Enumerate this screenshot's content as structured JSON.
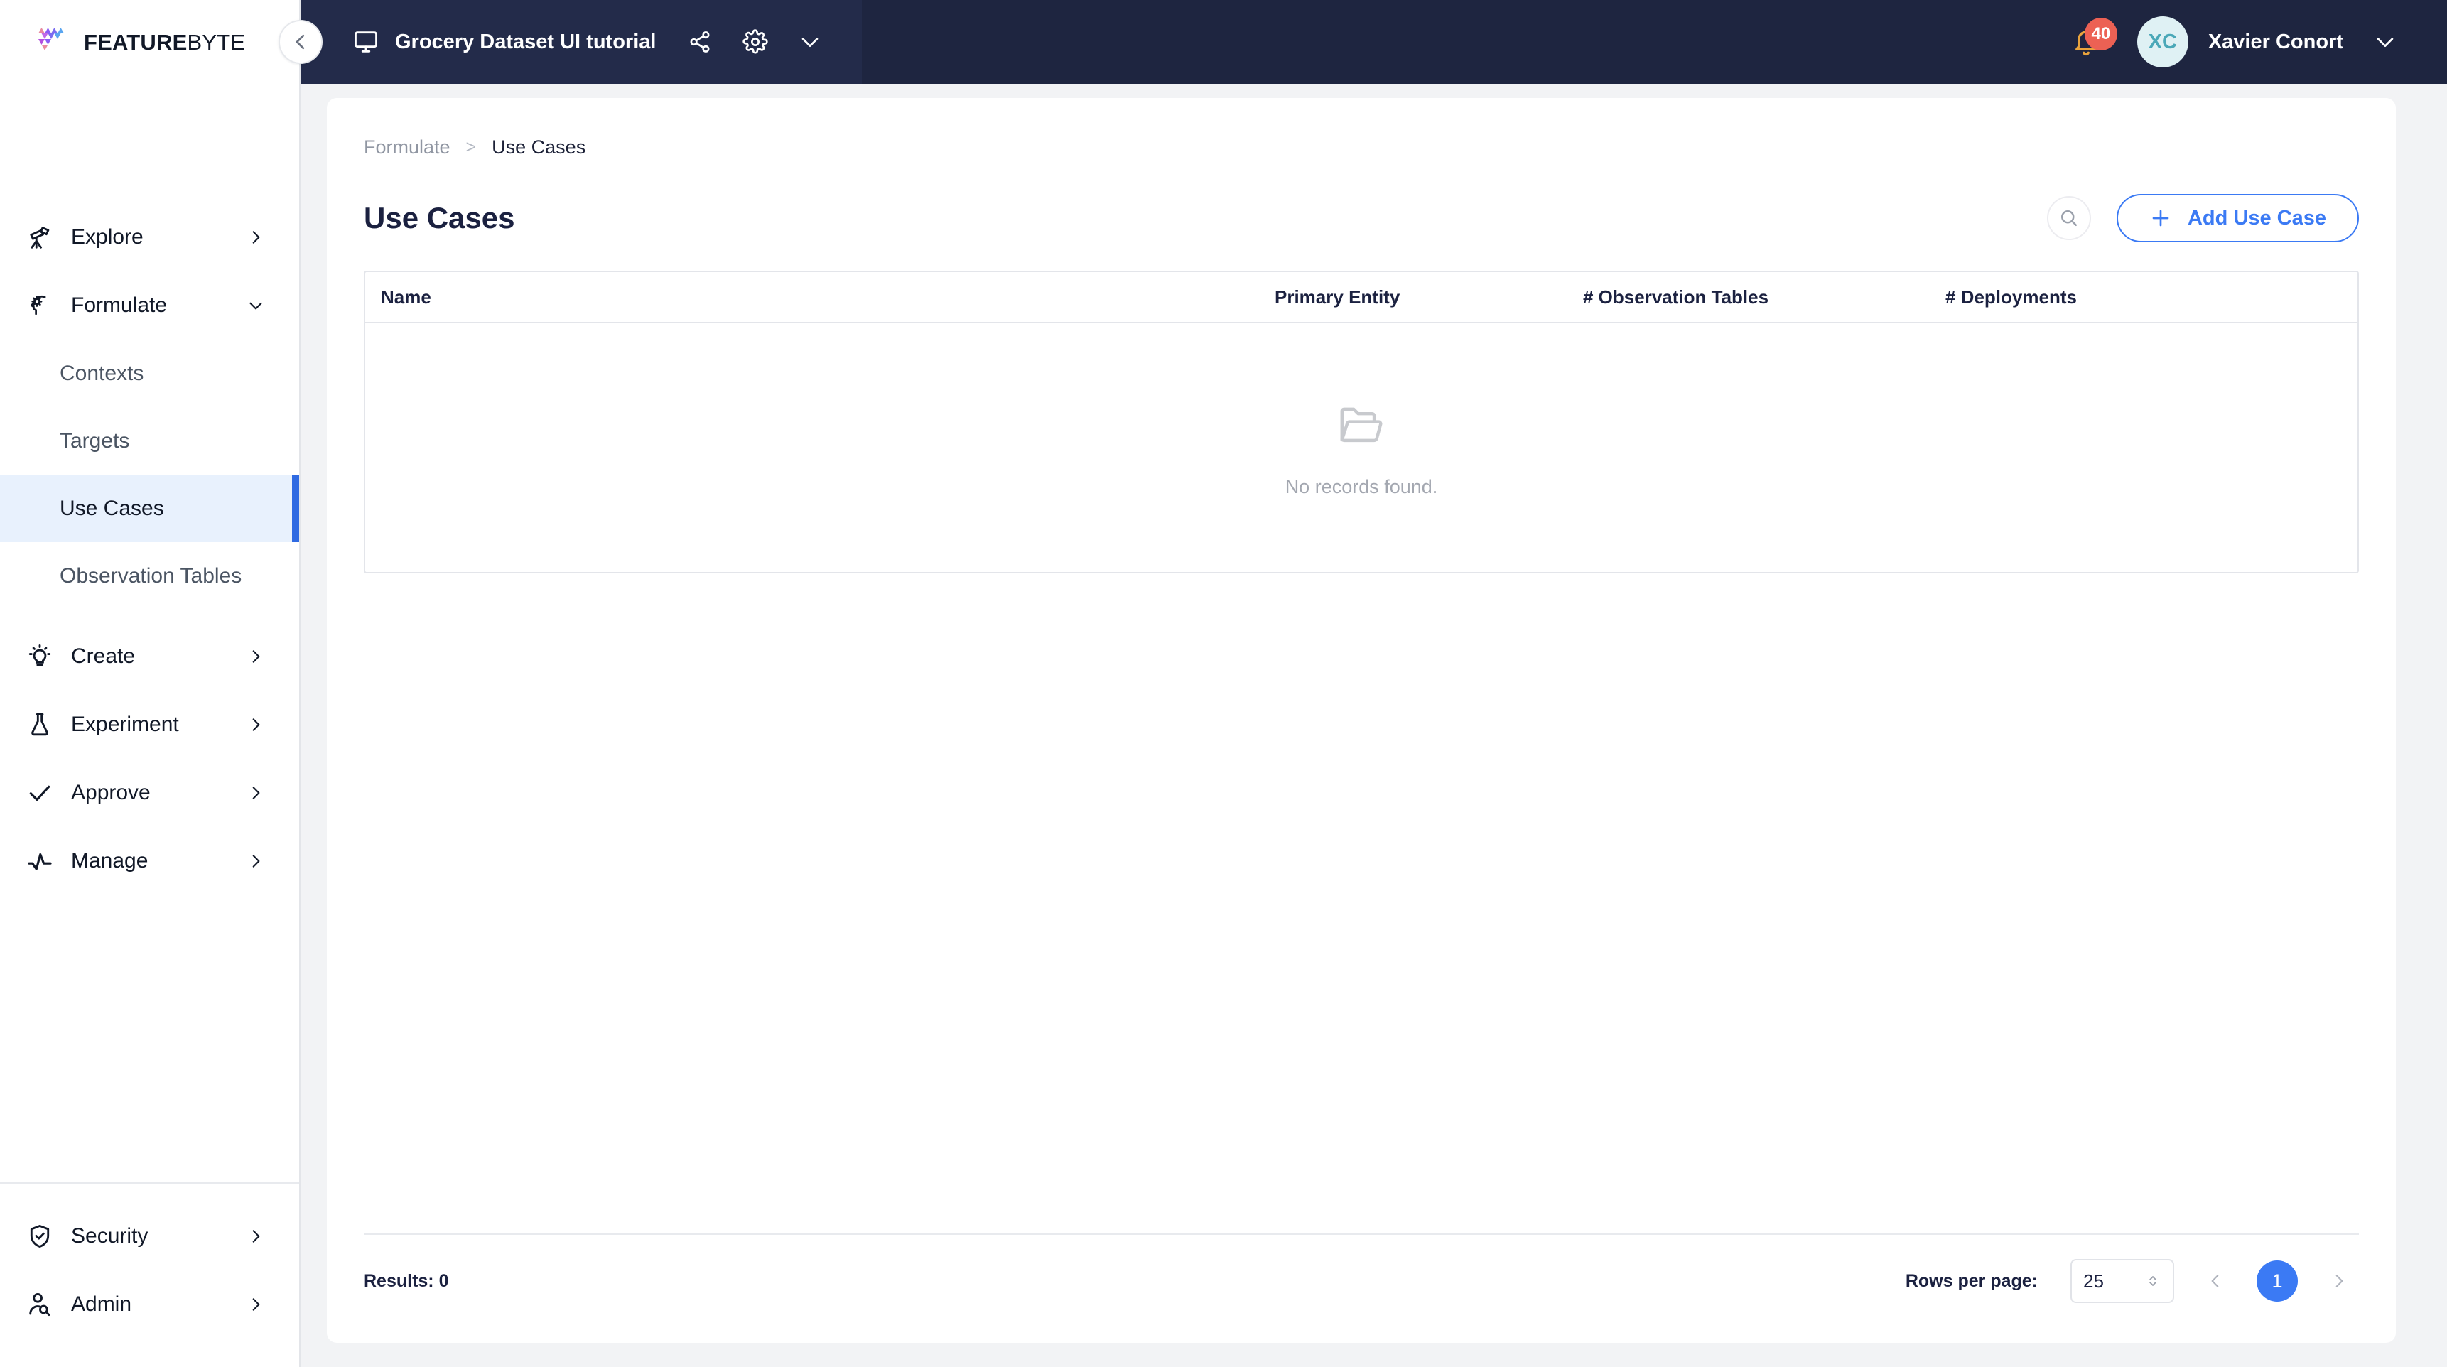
{
  "brand": {
    "name_bold": "FEATURE",
    "name_light": "BYTE",
    "accent": "#3b7af4"
  },
  "topbar": {
    "dataset_name": "Grocery Dataset UI tutorial",
    "share_icon": "share-icon",
    "settings_icon": "gear-icon",
    "dropdown_icon": "chevron-down-icon",
    "notification_count": "40",
    "user_initials": "XC",
    "user_name": "Xavier Conort"
  },
  "sidebar": {
    "collapse_icon": "chevron-left-icon",
    "top_items": [
      {
        "label": "Explore",
        "icon": "telescope-icon",
        "chevron": "chevron-right-icon",
        "expanded": false
      },
      {
        "label": "Formulate",
        "icon": "brain-gear-icon",
        "chevron": "chevron-down-icon",
        "expanded": true
      }
    ],
    "formulate_children": [
      {
        "label": "Contexts",
        "active": false
      },
      {
        "label": "Targets",
        "active": false
      },
      {
        "label": "Use Cases",
        "active": true
      },
      {
        "label": "Observation Tables",
        "active": false
      }
    ],
    "mid_items": [
      {
        "label": "Create",
        "icon": "lightbulb-icon",
        "chevron": "chevron-right-icon"
      },
      {
        "label": "Experiment",
        "icon": "flask-icon",
        "chevron": "chevron-right-icon"
      },
      {
        "label": "Approve",
        "icon": "check-icon",
        "chevron": "chevron-right-icon"
      },
      {
        "label": "Manage",
        "icon": "activity-pulse-icon",
        "chevron": "chevron-right-icon"
      }
    ],
    "bottom_items": [
      {
        "label": "Security",
        "icon": "shield-check-icon",
        "chevron": "chevron-right-icon"
      },
      {
        "label": "Admin",
        "icon": "user-search-icon",
        "chevron": "chevron-right-icon"
      }
    ]
  },
  "breadcrumb": {
    "parent": "Formulate",
    "separator": ">",
    "current": "Use Cases"
  },
  "page": {
    "title": "Use Cases",
    "search_icon": "search-icon",
    "add_button_label": "Add Use Case",
    "add_button_icon": "plus-icon"
  },
  "table": {
    "columns": [
      "Name",
      "Primary Entity",
      "# Observation Tables",
      "# Deployments"
    ],
    "rows": [],
    "empty_icon": "folder-open-icon",
    "empty_message": "No records found."
  },
  "footer": {
    "results_label": "Results: 0",
    "rows_per_page_label": "Rows per page:",
    "rows_per_page_value": "25",
    "prev_icon": "chevron-left-icon",
    "next_icon": "chevron-right-icon",
    "current_page": "1"
  }
}
